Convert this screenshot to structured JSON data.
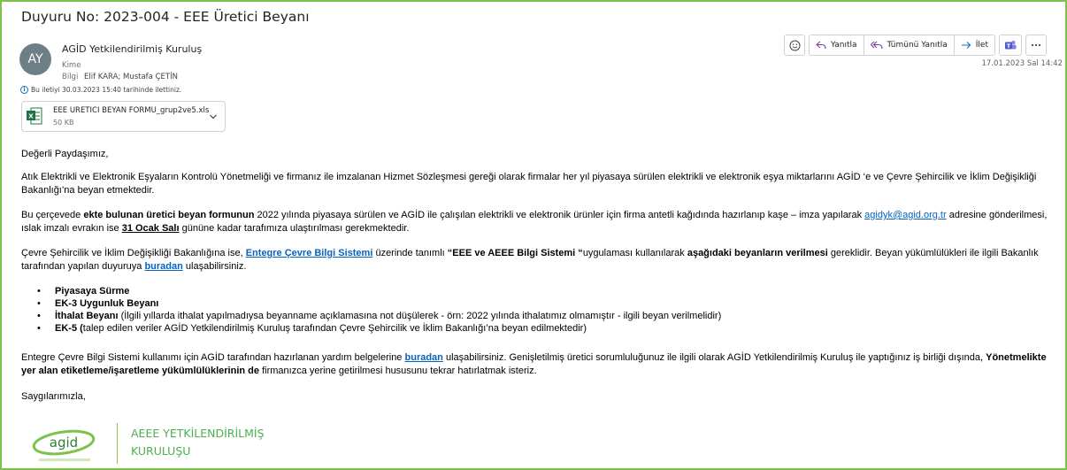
{
  "email": {
    "subject": "Duyuru No: 2023-004 - EEE Üretici Beyanı",
    "avatar_initials": "AY",
    "sender": "AGİD Yetkilendirilmiş Kuruluş",
    "to_label": "Kime",
    "cc_label": "Bilgi",
    "cc_value": "Elif KARA; Mustafa ÇETİN",
    "forward_info": "Bu iletiyi 30.03.2023 15:40 tarihinde ilettiniz.",
    "date": "17.01.2023 Sal 14:42"
  },
  "attachment": {
    "name": "EEE URETICI BEYAN FORMU_grup2ve5.xls",
    "size": "50 KB",
    "icon": "excel-file-icon"
  },
  "toolbar": {
    "reply": "Yanıtla",
    "reply_all": "Tümünü Yanıtla",
    "forward": "İlet"
  },
  "body": {
    "greeting": "Değerli Paydaşımız,",
    "p1": "Atık Elektrikli ve Elektronik Eşyaların Kontrolü Yönetmeliği ve firmanız ile imzalanan Hizmet Sözleşmesi gereği olarak firmalar her yıl piyasaya sürülen elektrikli ve elektronik eşya miktarlarını AGİD ‘e ve Çevre Şehircilik ve İklim Değişikliği Bakanlığı’na beyan etmektedir.",
    "p2_a": "Bu çerçevede ",
    "p2_b": "ekte bulunan üretici beyan formunun",
    "p2_c": " 2022 yılında piyasaya sürülen ve AGİD ile çalışılan elektrikli ve elektronik ürünler için firma antetli kağıdında hazırlanıp kaşe – imza yapılarak ",
    "p2_link": "agidyk@agid.org.tr",
    "p2_d": " adresine gönderilmesi, ıslak imzalı evrakın ise ",
    "p2_e": "31 Ocak Salı",
    "p2_f": " gününe kadar tarafımıza ulaştırılması gerekmektedir.",
    "p3_a": "Çevre Şehircilik ve İklim Değişikliği Bakanlığına ise, ",
    "p3_link": "Entegre Çevre Bilgi Sistemi",
    "p3_b": " üzerinde tanımlı ",
    "p3_c": "“EEE ve AEEE Bilgi Sistemi “",
    "p3_d": "uygulaması kullanılarak ",
    "p3_e": "aşağıdaki beyanların verilmesi",
    "p3_f": " gereklidir. Beyan yükümlülükleri ile ilgili Bakanlık tarafından yapılan duyuruya ",
    "p3_link2": "buradan",
    "p3_g": " ulaşabilirsiniz.",
    "bullet1": "Piyasaya Sürme",
    "bullet2": "EK-3 Uygunluk Beyanı",
    "bullet3_a": "İthalat Beyanı",
    "bullet3_b": " (İlgili yıllarda ithalat yapılmadıysa beyanname açıklamasına not düşülerek - ",
    "bullet3_c": "örn: 2022 yılında ithalatımız olmamıştır -",
    "bullet3_d": "  ilgili beyan verilmelidir)",
    "bullet4_a": "EK-5 (",
    "bullet4_b": "talep edilen veriler AGİD Yetkilendirilmiş Kuruluş tarafından Çevre Şehircilik ve İklim Bakanlığı’na beyan edilmektedir)",
    "p4_a": "Entegre Çevre Bilgi Sistemi kullanımı için AGİD tarafından hazırlanan yardım belgelerine ",
    "p4_link": "buradan",
    "p4_b": " ulaşabilirsiniz.  Genişletilmiş üretici sorumluluğunuz ile ilgili olarak AGİD Yetkilendirilmiş Kuruluş ile yaptığınız iş birliği dışında, ",
    "p4_c": "Yönetmelikte yer alan etiketleme/işaretleme yükümlülüklerinin de",
    "p4_d": " firmanızca yerine getirilmesi hususunu tekrar hatırlatmak isteriz.",
    "closing": "Saygılarımızla,"
  },
  "signature": {
    "logo_text": "agid",
    "line1": "AEEE YETKİLENDİRİLMİŞ",
    "line2": "KURULUŞU"
  },
  "colors": {
    "frame": "#7cc34a",
    "link": "#0563c1",
    "brand_green": "#4caf50",
    "teams": "#5059c9"
  }
}
